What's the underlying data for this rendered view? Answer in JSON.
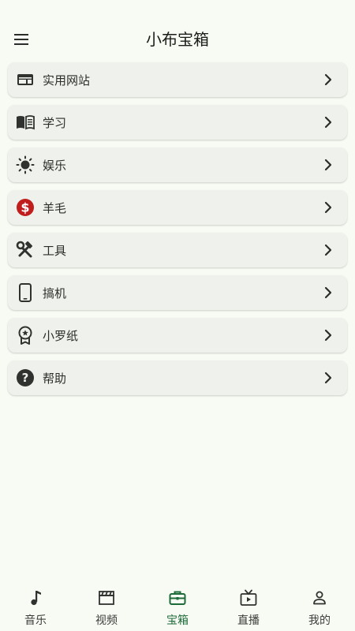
{
  "app": {
    "title": "小布宝箱"
  },
  "colors": {
    "background": "#f8fbf4",
    "card": "#eff2ec",
    "accent": "#1e6b3a",
    "money_icon": "#c01d1d"
  },
  "menu": {
    "icon": "hamburger-menu-icon"
  },
  "list": {
    "items": [
      {
        "label": "实用网站",
        "icon": "web-window-icon"
      },
      {
        "label": "学习",
        "icon": "book-icon"
      },
      {
        "label": "娱乐",
        "icon": "sun-icon"
      },
      {
        "label": "羊毛",
        "icon": "dollar-circle-icon"
      },
      {
        "label": "工具",
        "icon": "hammer-wrench-icon"
      },
      {
        "label": "搞机",
        "icon": "smartphone-icon"
      },
      {
        "label": "小罗纸",
        "icon": "award-badge-icon"
      },
      {
        "label": "帮助",
        "icon": "help-circle-icon"
      }
    ]
  },
  "bottom_nav": {
    "active_index": 2,
    "items": [
      {
        "label": "音乐",
        "icon": "music-note-icon"
      },
      {
        "label": "视频",
        "icon": "clapperboard-icon"
      },
      {
        "label": "宝箱",
        "icon": "briefcase-icon"
      },
      {
        "label": "直播",
        "icon": "live-tv-icon"
      },
      {
        "label": "我的",
        "icon": "person-icon"
      }
    ]
  }
}
